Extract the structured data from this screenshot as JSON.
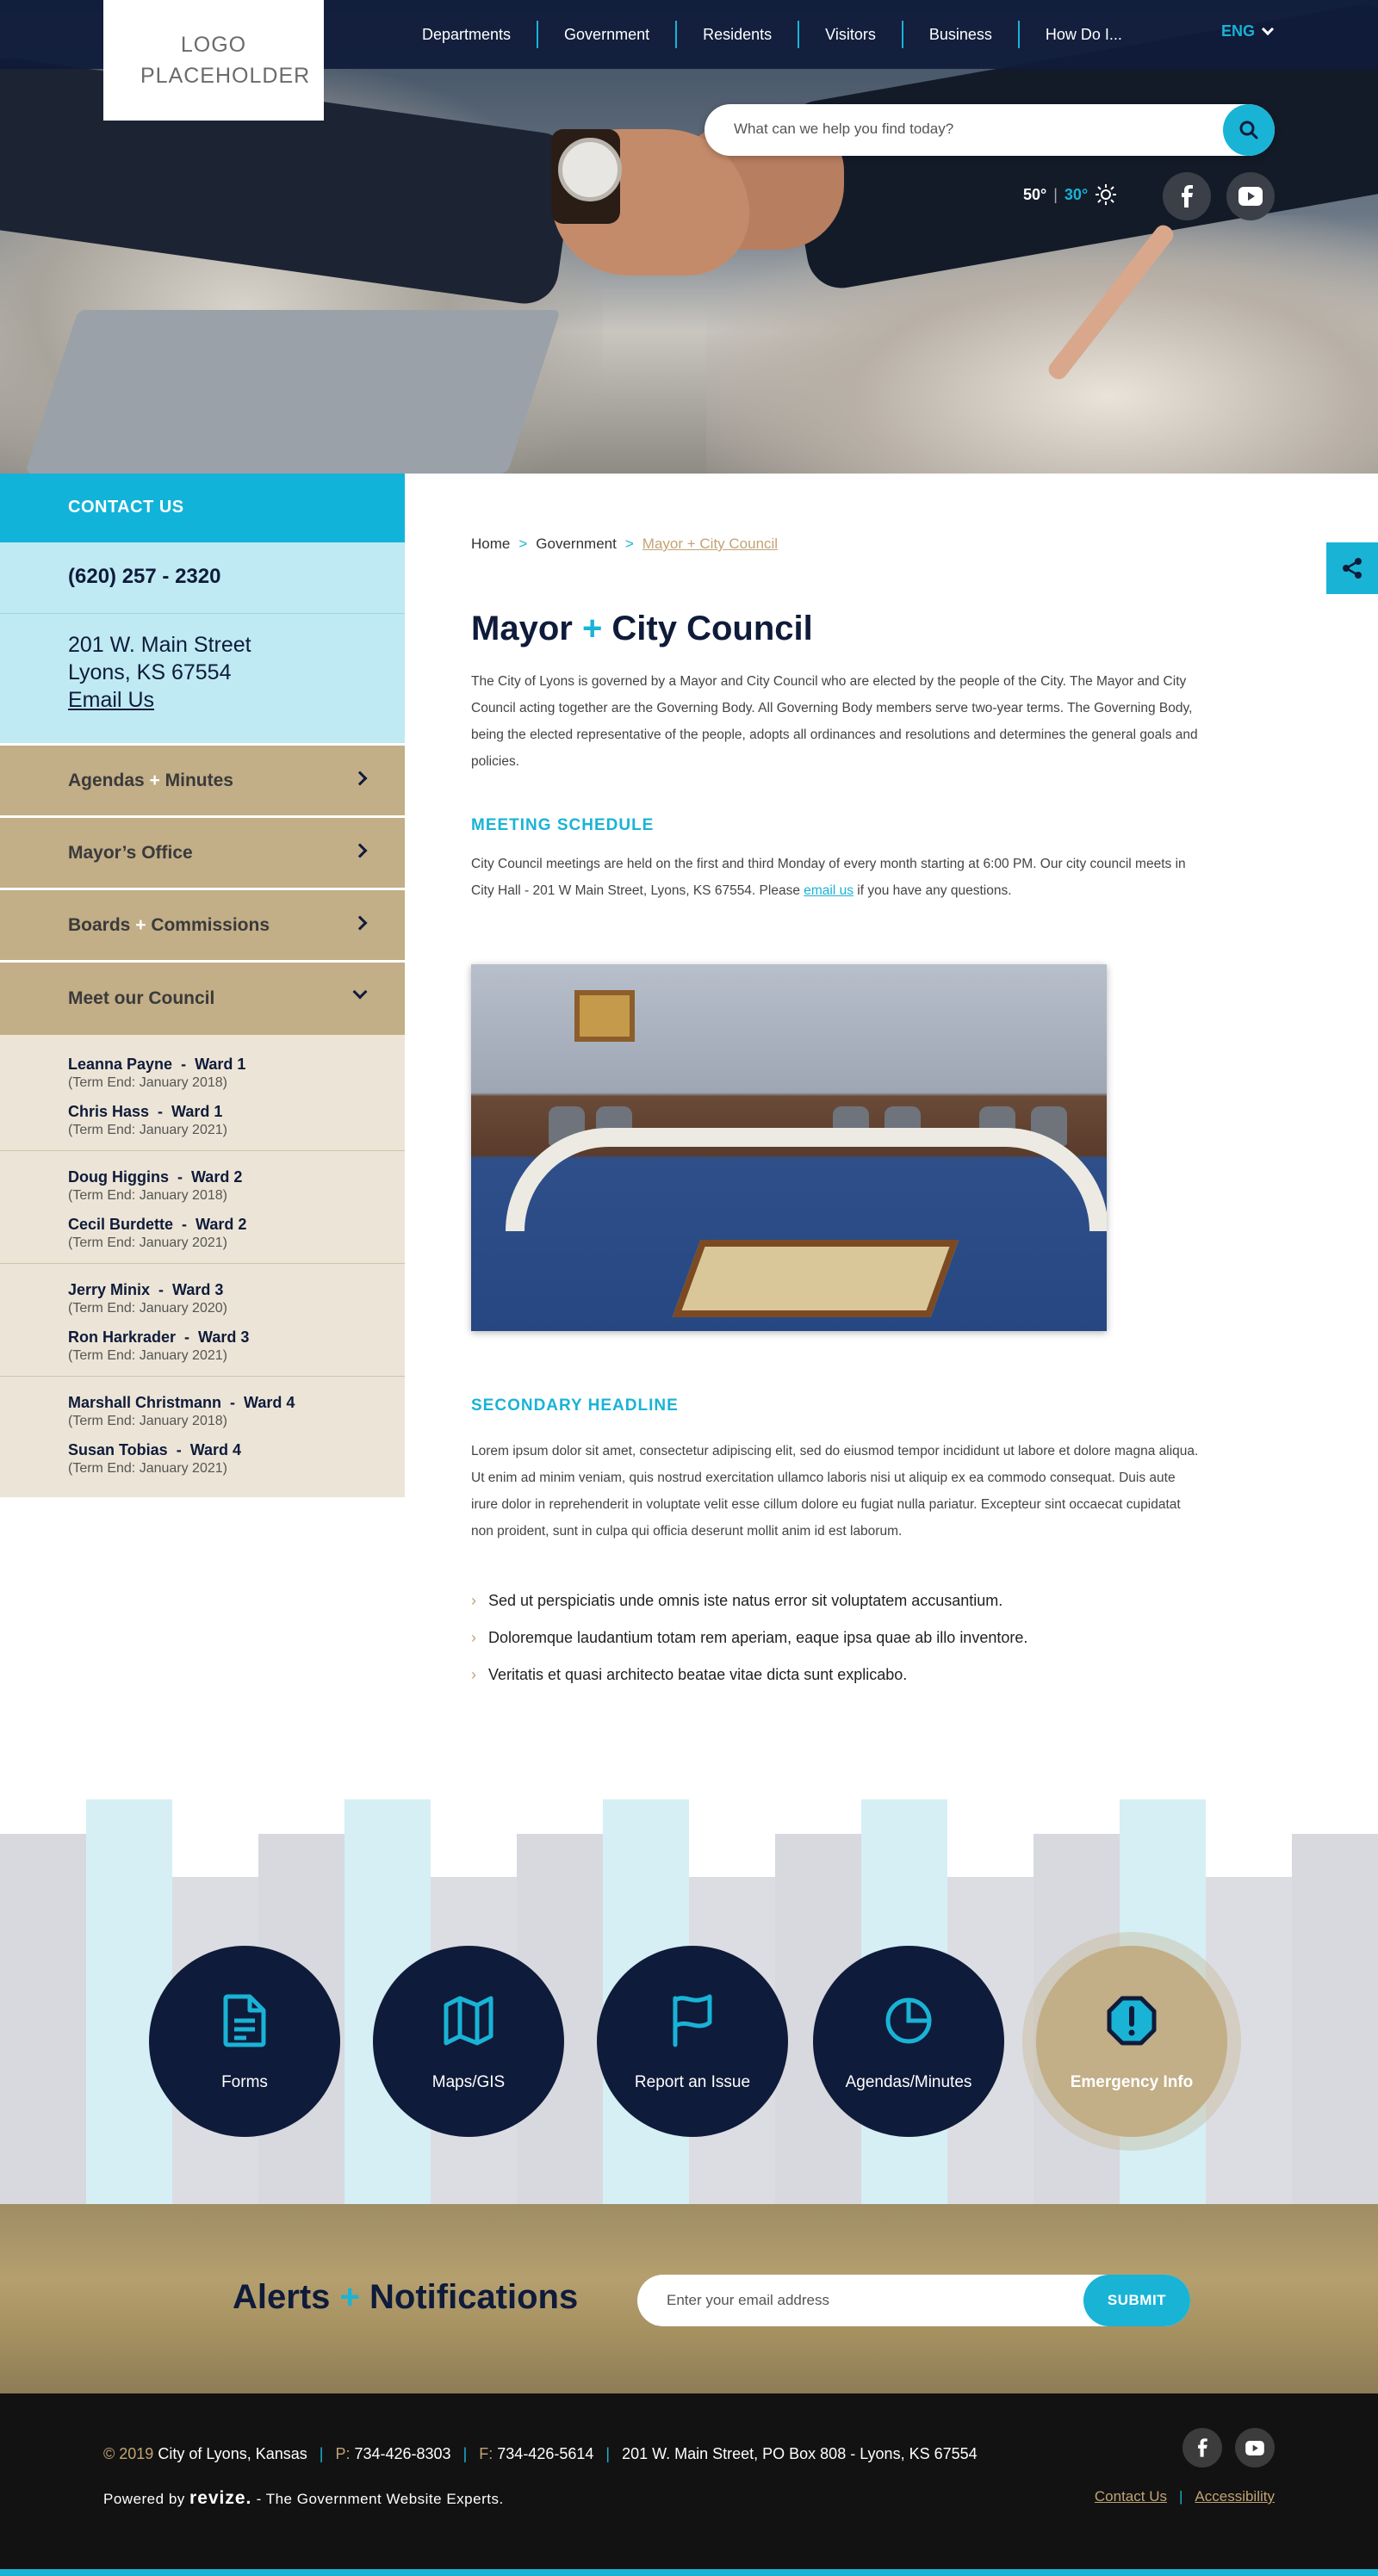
{
  "header": {
    "logo": "LOGO PLACEHOLDER",
    "nav": [
      "Departments",
      "Government",
      "Residents",
      "Visitors",
      "Business",
      "How Do I..."
    ],
    "language": "ENG",
    "search_placeholder": "What can we help you find today?",
    "weather": {
      "high": "50°",
      "low": "30°"
    },
    "social_icons": [
      "facebook-icon",
      "youtube-icon"
    ]
  },
  "sidebar": {
    "contact_title": "CONTACT US",
    "phone": "(620) 257 - 2320",
    "address_line1": "201 W. Main Street",
    "address_line2": "Lyons, KS 67554",
    "email_label": "Email Us",
    "items": [
      {
        "label_a": "Agendas",
        "plus": "+",
        "label_b": "Minutes"
      },
      {
        "label_a": "Mayor’s Office",
        "plus": "",
        "label_b": ""
      },
      {
        "label_a": "Boards",
        "plus": "+",
        "label_b": "Commissions"
      },
      {
        "label_a": "Meet our Council",
        "plus": "",
        "label_b": ""
      }
    ],
    "council": [
      [
        {
          "name": "Leanna Payne",
          "ward": "Ward 1",
          "term": "(Term End: January 2018)"
        },
        {
          "name": "Chris Hass",
          "ward": "Ward 1",
          "term": "(Term End: January 2021)"
        }
      ],
      [
        {
          "name": "Doug Higgins",
          "ward": "Ward 2",
          "term": "(Term End: January 2018)"
        },
        {
          "name": "Cecil Burdette",
          "ward": "Ward 2",
          "term": "(Term End: January 2021)"
        }
      ],
      [
        {
          "name": "Jerry Minix",
          "ward": "Ward 3",
          "term": "(Term End: January 2020)"
        },
        {
          "name": "Ron Harkrader",
          "ward": "Ward 3",
          "term": "(Term End: January 2021)"
        }
      ],
      [
        {
          "name": "Marshall Christmann",
          "ward": "Ward 4",
          "term": "(Term End: January 2018)"
        },
        {
          "name": "Susan Tobias",
          "ward": "Ward 4",
          "term": "(Term End: January 2021)"
        }
      ]
    ]
  },
  "main": {
    "breadcrumb": [
      "Home",
      "Government",
      "Mayor + City Council"
    ],
    "breadcrumb_sep": ">",
    "title_a": "Mayor",
    "title_plus": "+",
    "title_b": "City Council",
    "intro": "The City of Lyons is governed by a Mayor and City Council who are elected by the people of the City. The Mayor and City Council acting together are the Governing Body. All Governing Body members serve two-year terms. The Governing Body, being the elected representative of the people, adopts all ordinances and resolutions and determines the general goals and policies.",
    "meeting_heading": "MEETING SCHEDULE",
    "meeting_text_a": "City Council meetings are held on the first and third Monday of every month starting at 6:00 PM. Our city council meets in City Hall - 201 W Main Street, Lyons, KS 67554. Please ",
    "meeting_link": "email us",
    "meeting_text_b": " if you have any questions.",
    "secondary_heading": "SECONDARY HEADLINE",
    "lorem": "Lorem ipsum dolor sit amet, consectetur adipiscing elit, sed do eiusmod tempor incididunt ut labore et dolore magna aliqua. Ut enim ad minim veniam, quis nostrud exercitation ullamco laboris nisi ut aliquip ex ea commodo consequat. Duis aute irure dolor in reprehenderit in voluptate velit esse cillum dolore eu fugiat nulla pariatur. Excepteur sint occaecat cupidatat non proident, sunt in culpa qui officia deserunt mollit anim id est laborum.",
    "bullets": [
      "Sed ut perspiciatis unde omnis iste natus error sit voluptatem accusantium.",
      "Doloremque laudantium totam rem aperiam, eaque ipsa quae ab illo inventore.",
      "Veritatis et quasi architecto beatae vitae dicta sunt explicabo."
    ]
  },
  "quick_links": [
    {
      "label": "Forms",
      "icon": "document-icon"
    },
    {
      "label": "Maps/GIS",
      "icon": "map-icon"
    },
    {
      "label": "Report an Issue",
      "icon": "flag-icon"
    },
    {
      "label": "Agendas/Minutes",
      "icon": "pie-chart-icon"
    },
    {
      "label": "Emergency Info",
      "icon": "alert-octagon-icon"
    }
  ],
  "alerts": {
    "title_a": "Alerts",
    "title_plus": "+",
    "title_b": "Notifications",
    "email_placeholder": "Enter your email address",
    "submit": "SUBMIT"
  },
  "footer": {
    "copyright": "© 2019",
    "city": "City of Lyons, Kansas",
    "phone_label": "P:",
    "phone": "734-426-8303",
    "fax_label": "F:",
    "fax": "734-426-5614",
    "address": "201 W. Main Street, PO Box 808 - Lyons, KS 67554",
    "powered_prefix": "Powered by",
    "powered_brand": "revize.",
    "powered_suffix": "- The Government Website Experts.",
    "links": [
      "Contact Us",
      "Accessibility"
    ]
  },
  "colors": {
    "navy": "#0f1b3a",
    "teal": "#19b3d6",
    "tan": "#c2ae87",
    "gold": "#c2a374",
    "light_blue": "#bfeaf3",
    "cream": "#ece5d7"
  }
}
